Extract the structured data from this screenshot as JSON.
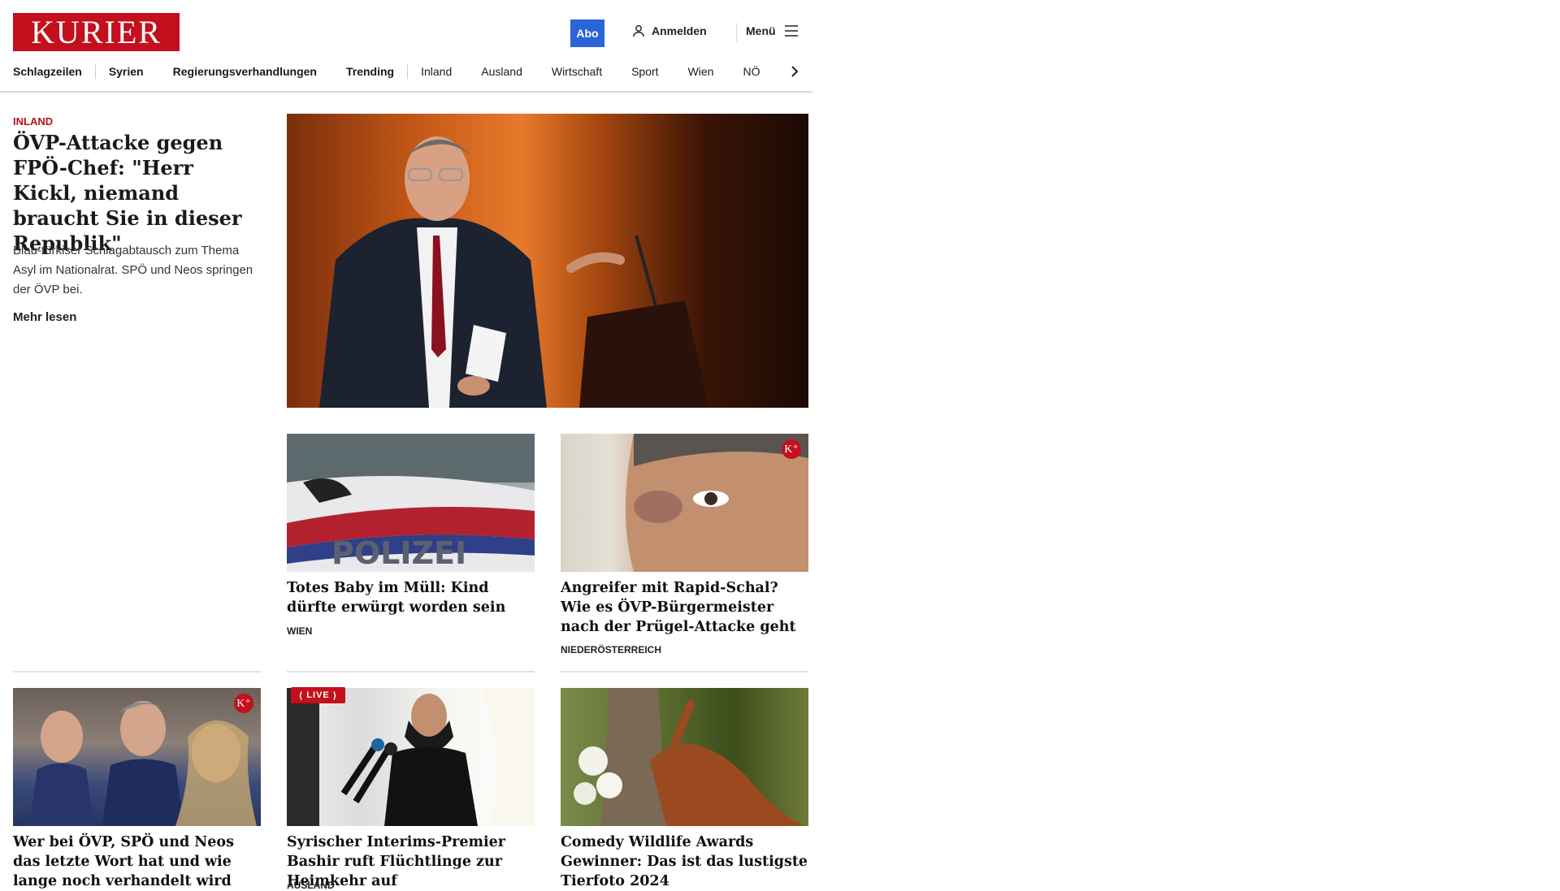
{
  "header": {
    "logo": "KURIER",
    "abo": "Abo",
    "login": "Anmelden",
    "menu": "Menü"
  },
  "nav": {
    "primary": [
      "Schlagzeilen",
      "Syrien",
      "Regierungsverhandlungen",
      "Trending"
    ],
    "secondary": [
      "Inland",
      "Ausland",
      "Wirtschaft",
      "Sport",
      "Wien",
      "NÖ"
    ]
  },
  "lead": {
    "kicker": "INLAND",
    "title": "ÖVP-Attacke gegen FPÖ-Chef: \"Herr Kickl, nie­mand braucht Sie in die­ser Republik\"",
    "subtitle": "Blau-türkiser Schlagabtausch zum Thema Asyl im Nationalrat. SPÖ und Neos springen der ÖVP bei.",
    "more": "Mehr lesen"
  },
  "cards": [
    {
      "title": "Totes Baby im Müll: Kind dürfte er­würgt worden sein",
      "tag": "WIEN",
      "image_text": "POLIZEI"
    },
    {
      "title": "Angreifer mit Rapid-Schal? Wie es ÖVP-Bürgermeister nach der Prü­gel-Attacke geht",
      "tag": "NIEDERÖSTERREICH",
      "badge": "K+"
    },
    {
      "title": "Wer bei ÖVP, SPÖ und Neos das letzte Wort hat und wie lange noch verhandelt wird",
      "tag": "",
      "badge": "K+"
    },
    {
      "title": "Syrischer Interims-Premier Bashir ruft Flüchtlinge zur Heimkehr auf",
      "tag": "AUSLAND",
      "live": "LIVE"
    },
    {
      "title": "Comedy Wildlife Awards Gewin­ner: Das ist das lustigste Tierfoto 2024",
      "tag": ""
    }
  ],
  "colors": {
    "brand": "#c40f1c",
    "abo": "#2b63d9"
  }
}
